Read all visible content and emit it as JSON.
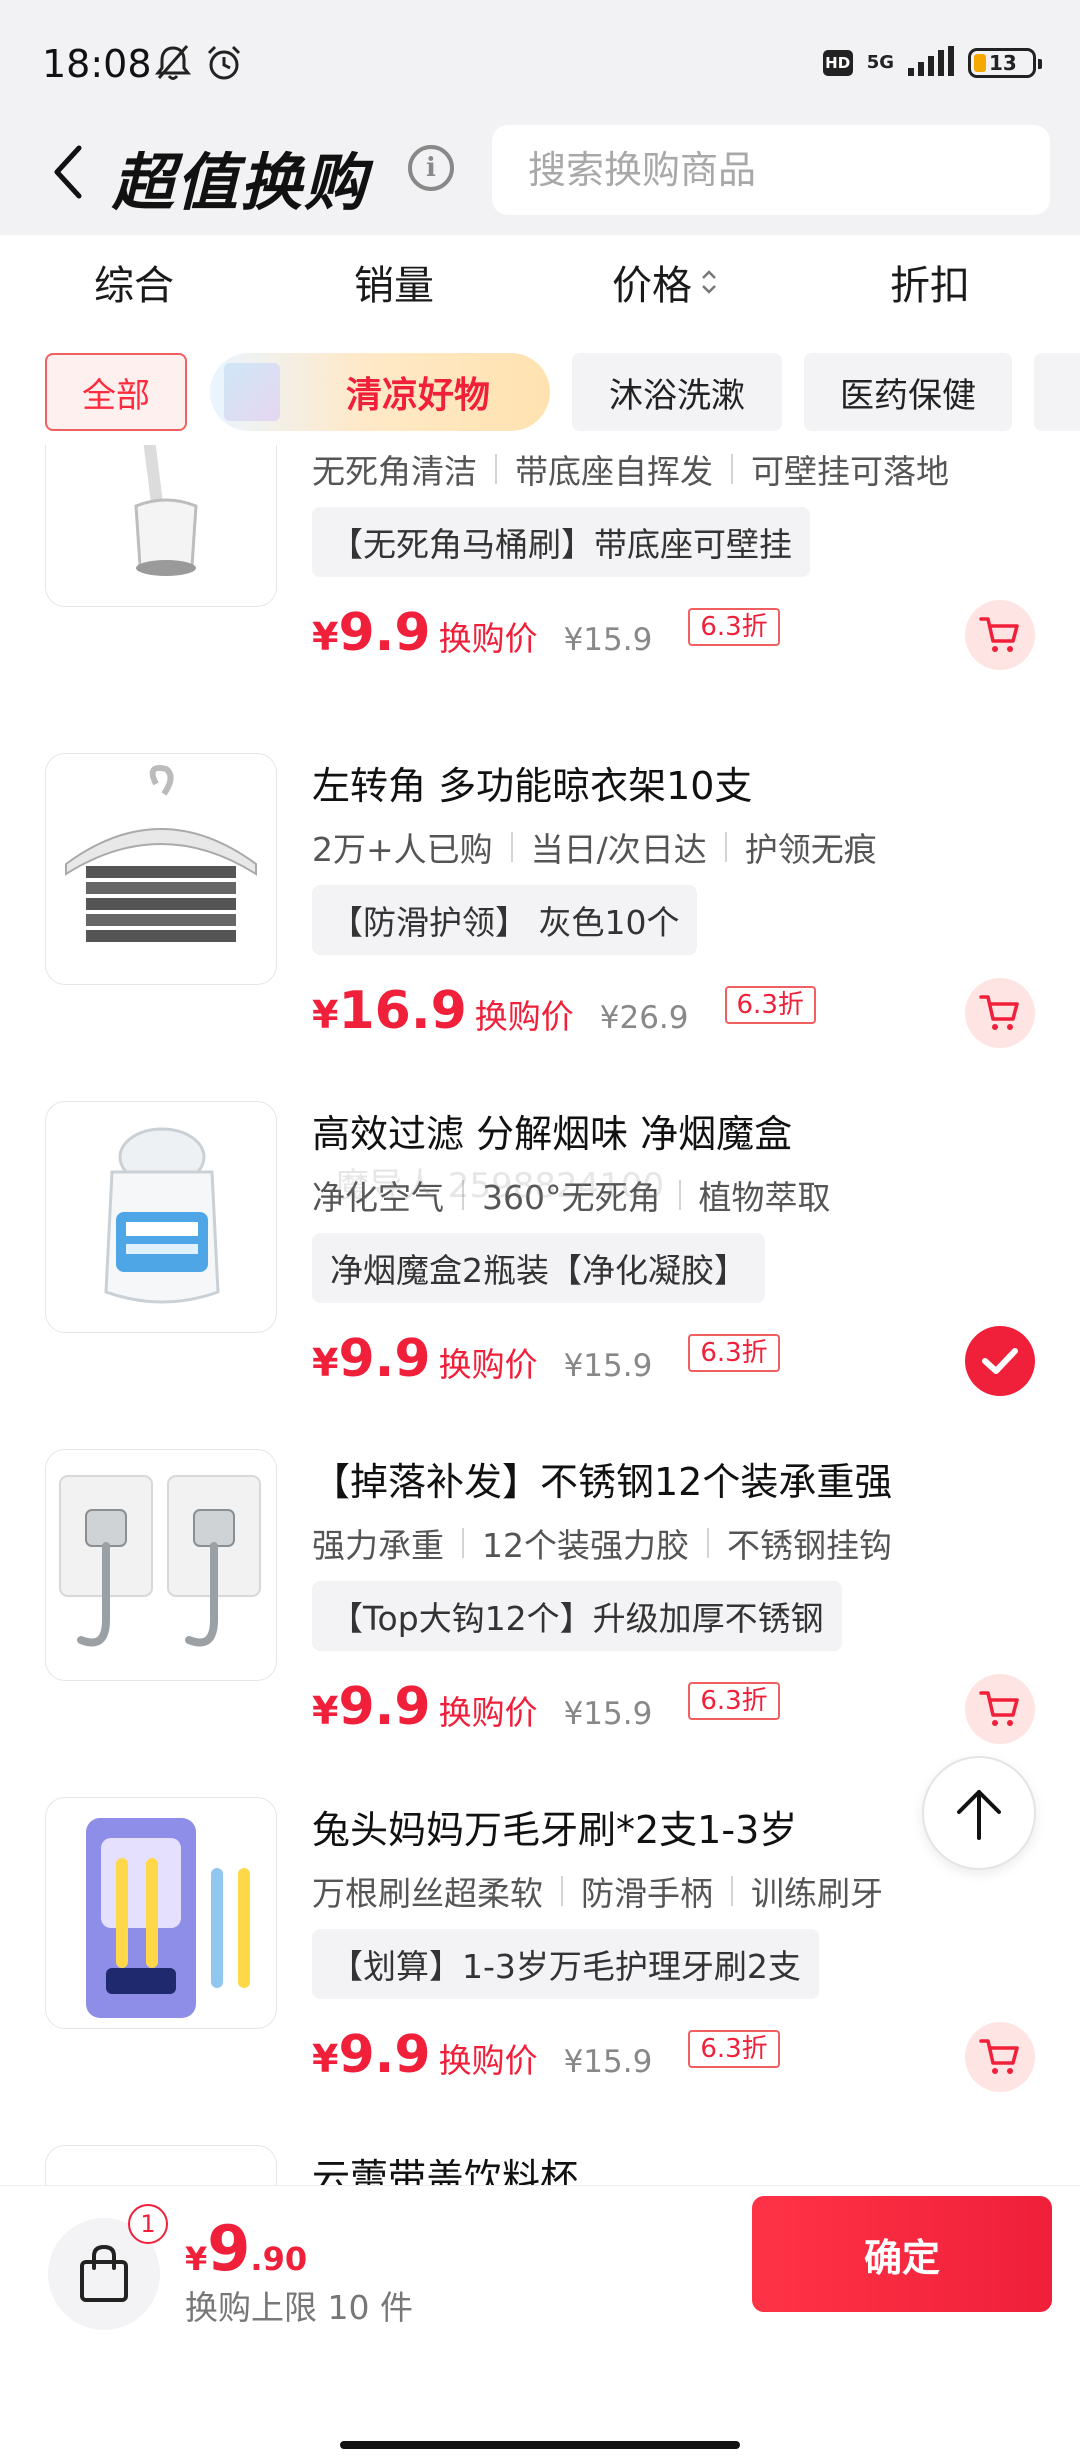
{
  "status_bar": {
    "time": "18:08",
    "network": "5G",
    "hd": "HD",
    "battery": "13"
  },
  "header": {
    "title": "超值换购",
    "search_placeholder": "搜索换购商品"
  },
  "sort_tabs": [
    "综合",
    "销量",
    "价格",
    "折扣"
  ],
  "categories": [
    "全部",
    "清凉好物",
    "沐浴洗漱",
    "医药保健"
  ],
  "products": [
    {
      "title": "",
      "features": [
        "无死角清洁",
        "带底座自挥发",
        "可壁挂可落地"
      ],
      "variant": "【无死角马桶刷】带底座可壁挂",
      "price_int": "9.9",
      "price_label": "换购价",
      "original": "¥15.9",
      "discount": "6.3折",
      "selected": false,
      "image_icon": "toilet-brush-image"
    },
    {
      "title": "左转角 多功能晾衣架10支",
      "features": [
        "2万+人已购",
        "当日/次日达",
        "护领无痕"
      ],
      "variant": "【防滑护领】 灰色10个",
      "price_int": "16.9",
      "price_label": "换购价",
      "original": "¥26.9",
      "discount": "6.3折",
      "selected": false,
      "image_icon": "clothes-hanger-image"
    },
    {
      "title": "高效过滤 分解烟味 净烟魔盒",
      "features": [
        "净化空气",
        "360°无死角",
        "植物萃取"
      ],
      "variant": "净烟魔盒2瓶装【净化凝胶】",
      "price_int": "9.9",
      "price_label": "换购价",
      "original": "¥15.9",
      "discount": "6.3折",
      "selected": true,
      "image_icon": "air-purifier-gel-image"
    },
    {
      "title": "【掉落补发】不锈钢12个装承重强",
      "features": [
        "强力承重",
        "12个装强力胶",
        "不锈钢挂钩"
      ],
      "variant": "【Top大钩12个】升级加厚不锈钢",
      "price_int": "9.9",
      "price_label": "换购价",
      "original": "¥15.9",
      "discount": "6.3折",
      "selected": false,
      "image_icon": "wall-hooks-image"
    },
    {
      "title": "兔头妈妈万毛牙刷*2支1-3岁",
      "features": [
        "万根刷丝超柔软",
        "防滑手柄",
        "训练刷牙"
      ],
      "variant": "【划算】1-3岁万毛护理牙刷2支",
      "price_int": "9.9",
      "price_label": "换购价",
      "original": "¥15.9",
      "discount": "6.3折",
      "selected": false,
      "image_icon": "toothbrush-image"
    },
    {
      "title": "云蕾带盖饮料杯",
      "features": [],
      "variant": "",
      "price_int": "",
      "price_label": "",
      "original": "",
      "discount": "",
      "selected": false,
      "image_icon": "cup-image"
    }
  ],
  "watermark": "魔导人 2598824100",
  "bottom_bar": {
    "cart_count": "1",
    "currency": "¥",
    "total_int": "9",
    "total_dec": ".90",
    "limit_text": "换购上限 10 件",
    "confirm_label": "确定"
  },
  "colors": {
    "accent": "#f0203a",
    "background": "#f2f2f4"
  }
}
